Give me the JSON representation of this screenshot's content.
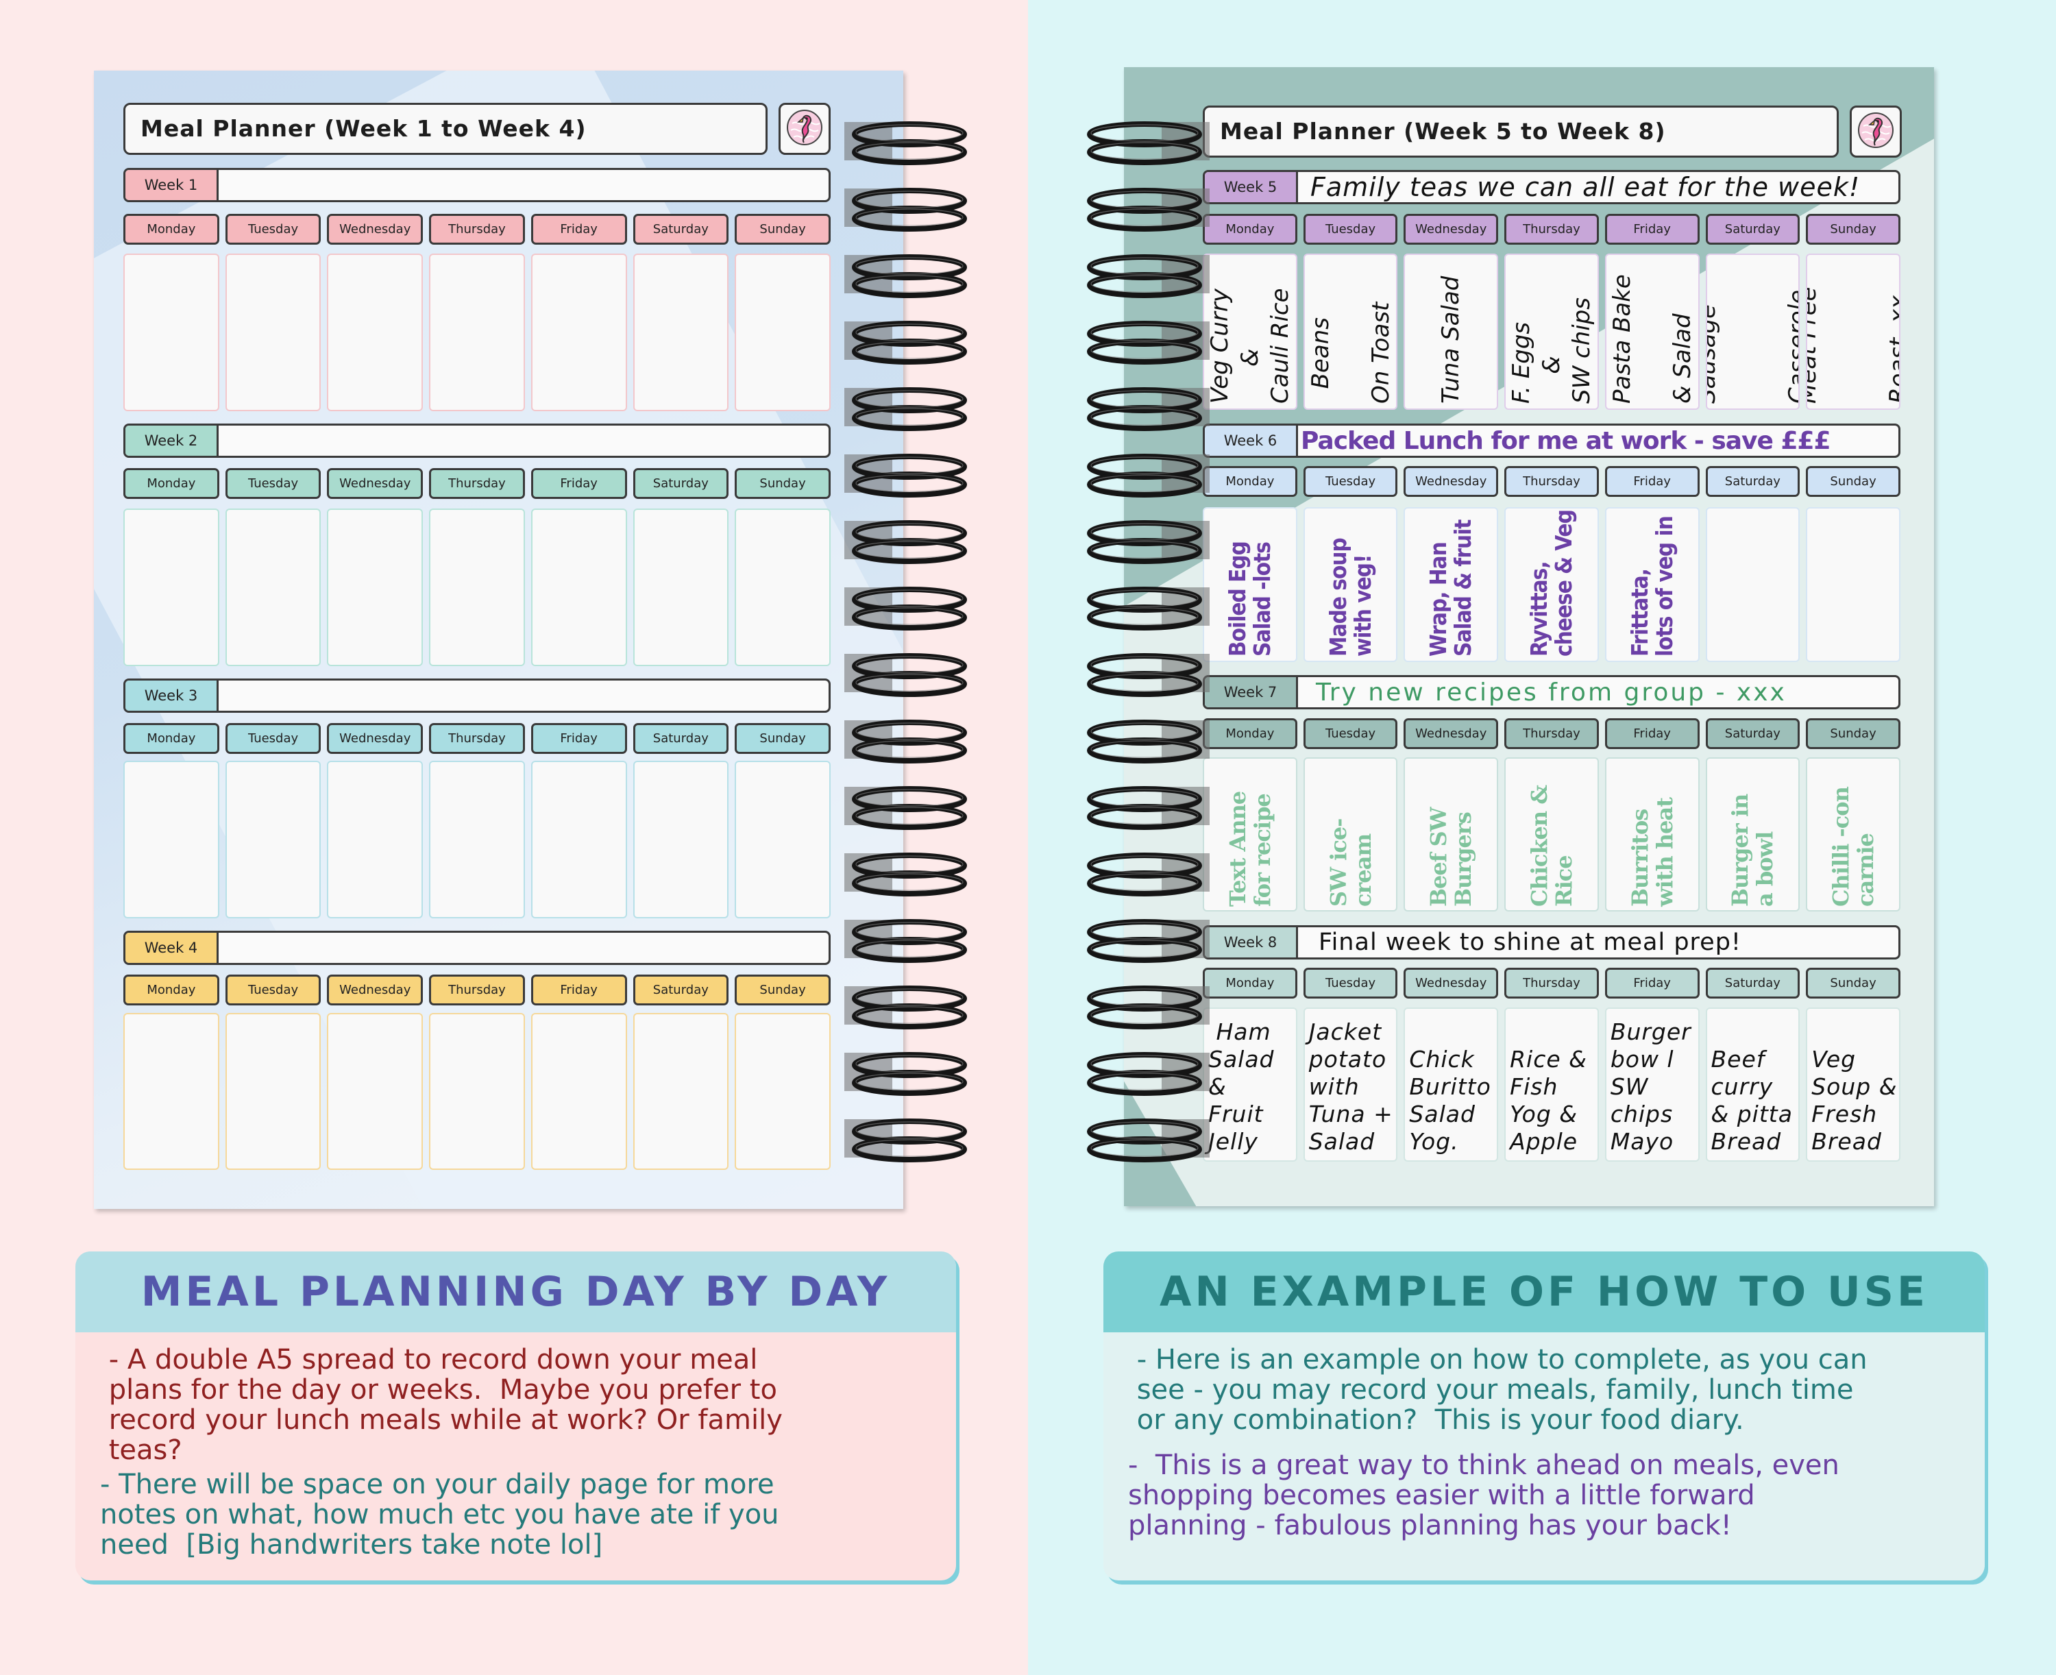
{
  "colors": {
    "bg_left": "#fdeaea",
    "bg_right": "#dcf6f7",
    "week_colors": [
      "#f5b8bd",
      "#a9dbce",
      "#a9dde2",
      "#f8d47c",
      "#c7a6d8",
      "#cfe2f5",
      "#9dbfb9",
      "#bcd9d5"
    ],
    "cell_borders": [
      "#f3c7cb",
      "#b8e4da",
      "#b7e0e8",
      "#f6d89a",
      "#e0cdea",
      "#d6e6f4",
      "#c9e0dc",
      "#d3e6e3"
    ]
  },
  "left_page": {
    "title": "Meal Planner (Week 1 to Week 4)",
    "logo_icon": "flamingo-icon",
    "weeks": [
      {
        "label": "Week 1",
        "note": "",
        "days": [
          "Monday",
          "Tuesday",
          "Wednesday",
          "Thursday",
          "Friday",
          "Saturday",
          "Sunday"
        ],
        "entries": [
          "",
          "",
          "",
          "",
          "",
          "",
          ""
        ]
      },
      {
        "label": "Week 2",
        "note": "",
        "days": [
          "Monday",
          "Tuesday",
          "Wednesday",
          "Thursday",
          "Friday",
          "Saturday",
          "Sunday"
        ],
        "entries": [
          "",
          "",
          "",
          "",
          "",
          "",
          ""
        ]
      },
      {
        "label": "Week 3",
        "note": "",
        "days": [
          "Monday",
          "Tuesday",
          "Wednesday",
          "Thursday",
          "Friday",
          "Saturday",
          "Sunday"
        ],
        "entries": [
          "",
          "",
          "",
          "",
          "",
          "",
          ""
        ]
      },
      {
        "label": "Week 4",
        "note": "",
        "days": [
          "Monday",
          "Tuesday",
          "Wednesday",
          "Thursday",
          "Friday",
          "Saturday",
          "Sunday"
        ],
        "entries": [
          "",
          "",
          "",
          "",
          "",
          "",
          ""
        ]
      }
    ]
  },
  "right_page": {
    "title": "Meal Planner (Week 5 to Week 8)",
    "logo_icon": "flamingo-icon",
    "weeks": [
      {
        "label": "Week 5",
        "note": "Family teas we can all eat for the week!",
        "note_color": "#111111",
        "days": [
          "Monday",
          "Tuesday",
          "Wednesday",
          "Thursday",
          "Friday",
          "Saturday",
          "Sunday"
        ],
        "entries": [
          "Veg Curry\n     &\nCauli Rice",
          "  Beans\n\nOn Toast",
          "Tuna Salad",
          "F. Eggs\n    &\nSW chips",
          "Pasta Bake\n\n& Salad",
          "Sausage\n\n\nCasserole",
          "Meat Free\n\n\nRoast  xx"
        ]
      },
      {
        "label": "Week 6",
        "note": "Packed Lunch for me at work - save £££",
        "note_color": "#6b3fa6",
        "days": [
          "Monday",
          "Tuesday",
          "Wednesday",
          "Thursday",
          "Friday",
          "Saturday",
          "Sunday"
        ],
        "entries": [
          "Boiled Egg\nSalad -lots",
          "Made soup\nwith veg!",
          "Wrap, Han\nSalad & fruit",
          "Ryvittas,\ncheese & Veg",
          "Frittata,\nlots of veg in",
          "",
          ""
        ]
      },
      {
        "label": "Week 7",
        "note": "Try new recipes from group - xxx",
        "note_color": "#3f9a64",
        "days": [
          "Monday",
          "Tuesday",
          "Wednesday",
          "Thursday",
          "Friday",
          "Saturday",
          "Sunday"
        ],
        "entries": [
          "Text Anne\nfor recipe",
          "SW ice-\ncream",
          "Beef SW\nBurgers",
          "Chicken &\nRice",
          "Burritos\nwith heat",
          "Burger in\na bowl",
          "Chilli -con\ncarnie"
        ]
      },
      {
        "label": "Week 8",
        "note": "Final week to shine at meal prep!",
        "note_color": "#111111",
        "days": [
          "Monday",
          "Tuesday",
          "Wednesday",
          "Thursday",
          "Friday",
          "Saturday",
          "Sunday"
        ],
        "entries": [
          " Ham\nSalad\n&\nFruit\nJelly",
          "Jacket\npotato\nwith\nTuna +\nSalad",
          "\nChick\nBuritto\nSalad\nYog.",
          "\nRice &\nFish\nYog &\nApple",
          "Burger\nbow l\nSW\nchips\nMayo",
          "\nBeef\ncurry\n& pitta\nBread",
          "\nVeg\nSoup &\nFresh\nBread"
        ]
      }
    ]
  },
  "captions": {
    "left": {
      "heading": "MEAL PLANNING DAY BY DAY",
      "paragraphs": [
        {
          "text": " - A double A5 spread to record down your meal\n plans for the day or weeks.  Maybe you prefer to\n record your lunch meals while at work? Or family\n teas?",
          "color": "#8f2020"
        },
        {
          "text": "- There will be space on your daily page for more\nnotes on what, how much etc you have ate if you\nneed  [Big handwriters take note lol]",
          "color": "#237a7a"
        }
      ]
    },
    "right": {
      "heading": "AN EXAMPLE OF HOW TO USE",
      "paragraphs": [
        {
          "text": " - Here is an example on how to complete, as you can\n see - you may record your meals, family, lunch time\n or any combination?  This is your food diary.",
          "color": "#237a7a"
        },
        {
          "text": "-  This is a great way to think ahead on meals, even\nshopping becomes easier with a little forward\nplanning - fabulous planning has your back!",
          "color": "#6a3fa0"
        }
      ]
    }
  }
}
